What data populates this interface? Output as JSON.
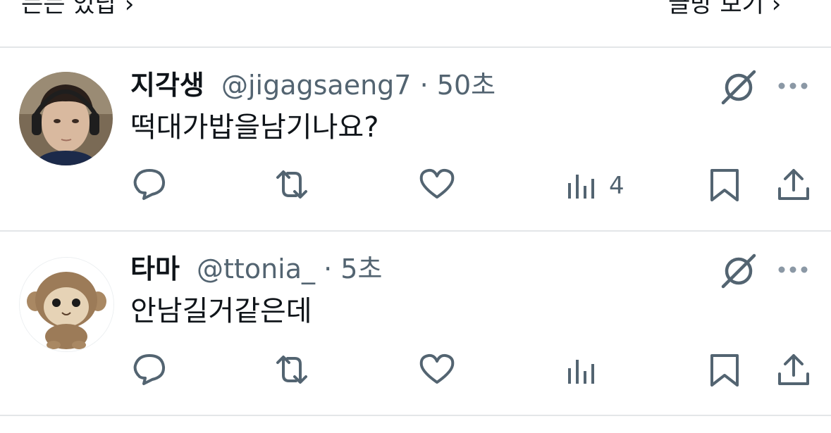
{
  "top": {
    "left_text": "는는 있답 ›",
    "right_text": "글방 보기 ›"
  },
  "tweets": [
    {
      "name": "지각생",
      "handle": "@jigagsaeng7",
      "separator": "·",
      "time": "50초",
      "text": "떡대가밥을남기나요?",
      "views": "4",
      "avatar": "photo of person with headphones"
    },
    {
      "name": "타마",
      "handle": "@ttonia_",
      "separator": "·",
      "time": "5초",
      "text": "안남길거같은데",
      "views": "",
      "avatar": "plush monkey toy"
    }
  ],
  "icons": {
    "reply": "reply-icon",
    "retweet": "retweet-icon",
    "like": "like-icon",
    "views": "views-icon",
    "bookmark": "bookmark-icon",
    "share": "share-icon",
    "grok": "grok-icon",
    "more": "more-icon"
  },
  "colors": {
    "icon_gray": "#536471",
    "text": "#0f1419",
    "divider": "#e3e6e8"
  }
}
